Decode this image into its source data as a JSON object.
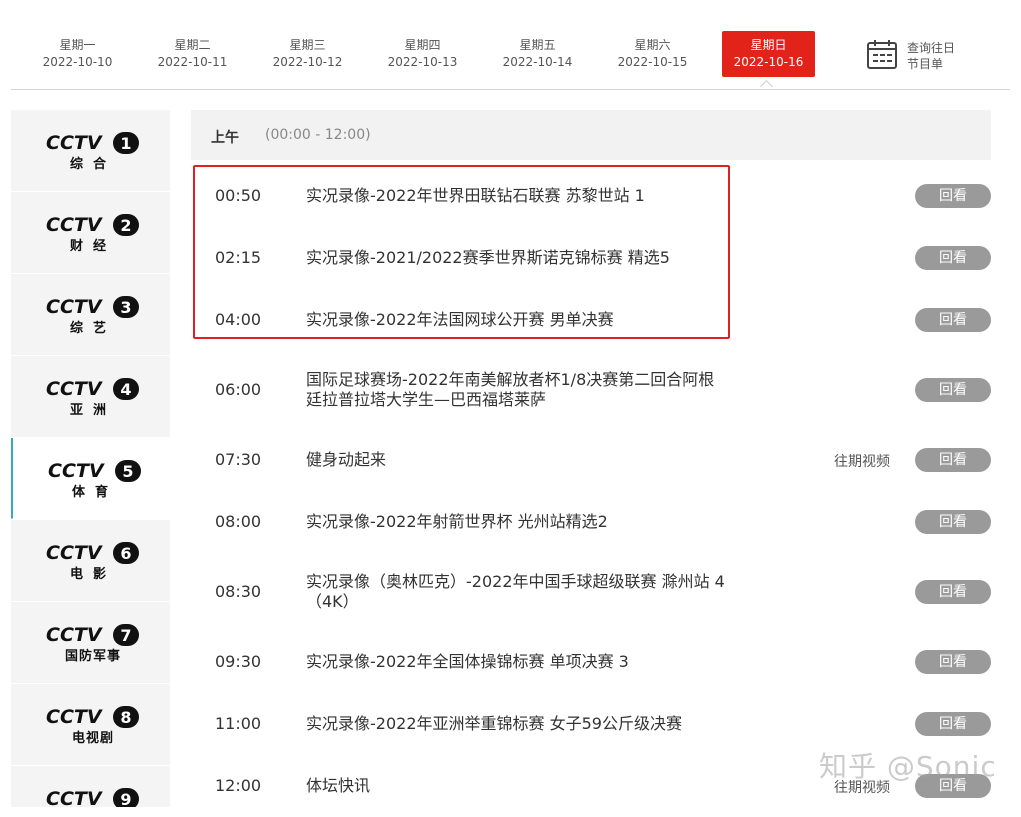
{
  "date_tabs": [
    {
      "weekday": "星期一",
      "date": "2022-10-10",
      "active": false
    },
    {
      "weekday": "星期二",
      "date": "2022-10-11",
      "active": false
    },
    {
      "weekday": "星期三",
      "date": "2022-10-12",
      "active": false
    },
    {
      "weekday": "星期四",
      "date": "2022-10-13",
      "active": false
    },
    {
      "weekday": "星期五",
      "date": "2022-10-14",
      "active": false
    },
    {
      "weekday": "星期六",
      "date": "2022-10-15",
      "active": false
    },
    {
      "weekday": "星期日",
      "date": "2022-10-16",
      "active": true
    }
  ],
  "history": {
    "line1": "查询往日",
    "line2": "节目单",
    "icon": "calendar-icon"
  },
  "channels": [
    {
      "number": "1",
      "name": "综合",
      "logo": "CCTV",
      "active": false
    },
    {
      "number": "2",
      "name": "财经",
      "logo": "CCTV",
      "active": false
    },
    {
      "number": "3",
      "name": "综艺",
      "logo": "CCTV",
      "active": false
    },
    {
      "number": "4",
      "name": "亚洲",
      "logo": "CCTV",
      "active": false
    },
    {
      "number": "5",
      "name": "体育",
      "logo": "CCTV",
      "active": true
    },
    {
      "number": "6",
      "name": "电影",
      "logo": "CCTV",
      "active": false
    },
    {
      "number": "7",
      "name": "国防军事",
      "logo": "CCTV",
      "active": false
    },
    {
      "number": "8",
      "name": "电视剧",
      "logo": "CCTV",
      "active": false
    },
    {
      "number": "9",
      "name": "",
      "logo": "CCTV",
      "active": false
    }
  ],
  "period": {
    "name": "上午",
    "range": "(00:00 - 12:00)"
  },
  "programs": [
    {
      "time": "00:50",
      "title": "实况录像-2022年世界田联钻石联赛 苏黎世站 1",
      "extra": "",
      "replay": "回看"
    },
    {
      "time": "02:15",
      "title": "实况录像-2021/2022赛季世界斯诺克锦标赛 精选5",
      "extra": "",
      "replay": "回看"
    },
    {
      "time": "04:00",
      "title": "实况录像-2022年法国网球公开赛 男单决赛",
      "extra": "",
      "replay": "回看"
    },
    {
      "time": "06:00",
      "title": "国际足球赛场-2022年南美解放者杯1/8决赛第二回合阿根廷拉普拉塔大学生—巴西福塔莱萨",
      "extra": "",
      "replay": "回看"
    },
    {
      "time": "07:30",
      "title": "健身动起来",
      "extra": "往期视频",
      "replay": "回看"
    },
    {
      "time": "08:00",
      "title": "实况录像-2022年射箭世界杯 光州站精选2",
      "extra": "",
      "replay": "回看"
    },
    {
      "time": "08:30",
      "title": "实况录像（奥林匹克）-2022年中国手球超级联赛 滁州站 4（4K）",
      "extra": "",
      "replay": "回看"
    },
    {
      "time": "09:30",
      "title": "实况录像-2022年全国体操锦标赛 单项决赛 3",
      "extra": "",
      "replay": "回看"
    },
    {
      "time": "11:00",
      "title": "实况录像-2022年亚洲举重锦标赛 女子59公斤级决赛",
      "extra": "",
      "replay": "回看"
    },
    {
      "time": "12:00",
      "title": "体坛快讯",
      "extra": "往期视频",
      "replay": "回看"
    }
  ],
  "watermark": "知乎 @Sonic",
  "colors": {
    "accent_red": "#e2231a",
    "replay_gray": "#9a9a9a",
    "active_channel_border": "#34a9c1"
  }
}
